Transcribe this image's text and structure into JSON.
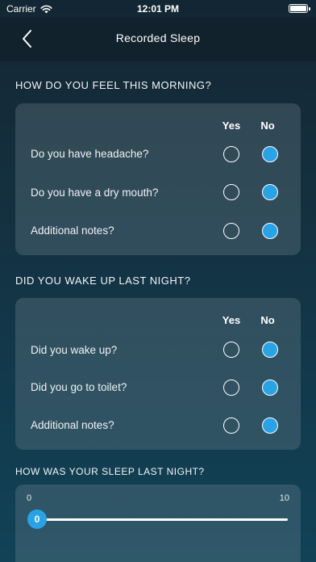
{
  "status_bar": {
    "carrier": "Carrier",
    "time": "12:01 PM"
  },
  "nav": {
    "title": "Recorded Sleep"
  },
  "morning": {
    "title": "HOW DO YOU FEEL THIS MORNING?",
    "yes_label": "Yes",
    "no_label": "No",
    "questions": [
      {
        "label": "Do you have headache?",
        "answer": "No"
      },
      {
        "label": "Do you have a dry mouth?",
        "answer": "No"
      },
      {
        "label": "Additional notes?",
        "answer": "No"
      }
    ]
  },
  "night": {
    "title": "DID YOU WAKE UP LAST NIGHT?",
    "yes_label": "Yes",
    "no_label": "No",
    "questions": [
      {
        "label": "Did you wake up?",
        "answer": "No"
      },
      {
        "label": "Did you go to toilet?",
        "answer": "No"
      },
      {
        "label": "Additional notes?",
        "answer": "No"
      }
    ]
  },
  "sleep_quality": {
    "title": "HOW WAS YOUR SLEEP LAST NIGHT?",
    "min": "0",
    "max": "10",
    "value": "0"
  },
  "colors": {
    "accent": "#29a3e6",
    "nav_bg": "#12222d"
  }
}
